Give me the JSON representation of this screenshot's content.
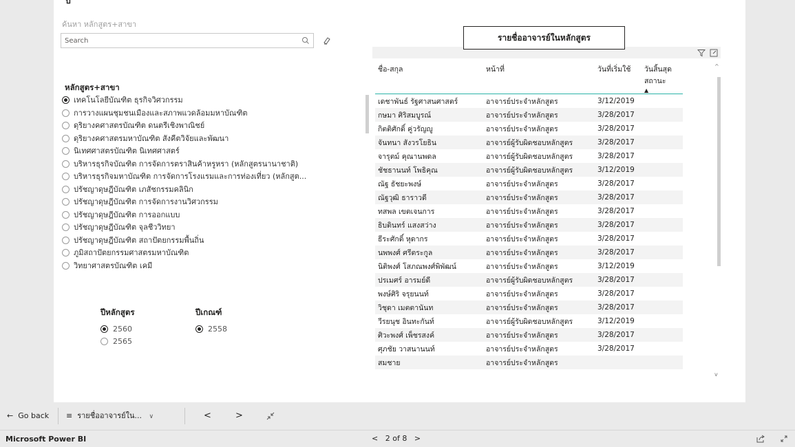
{
  "report": {
    "clipped_glyph": "ป",
    "search": {
      "caption": "ค้นหา หลักสูตร+สาขา",
      "placeholder": "Search"
    },
    "slicer": {
      "title": "หลักสูตร+สาขา",
      "items": [
        {
          "label": "เทคโนโลยีบัณฑิต ธุรกิจวิศวกรรม",
          "selected": true
        },
        {
          "label": "การวางแผนชุมชนเมืองและสภาพแวดล้อมมหาบัณฑิต",
          "selected": false
        },
        {
          "label": "ดุริยางคศาสตรบัณฑิต ดนตรีเชิงพาณิชย์",
          "selected": false
        },
        {
          "label": "ดุริยางคศาสตรมหาบัณฑิต สังคีตวิจัยและพัฒนา",
          "selected": false
        },
        {
          "label": "นิเทศศาสตรบัณฑิต นิเทศศาสตร์",
          "selected": false
        },
        {
          "label": "บริหารธุรกิจบัณฑิต การจัดการตราสินค้าหรูหรา (หลักสูตรนานาชาติ)",
          "selected": false
        },
        {
          "label": "บริหารธุรกิจมหาบัณฑิต  การจัดการโรงแรมและการท่องเที่ยว (หลักสูต...",
          "selected": false
        },
        {
          "label": "ปรัชญาดุษฎีบัณฑิต เภสัชกรรมคลินิก",
          "selected": false
        },
        {
          "label": "ปรัชญาดุษฎีบัณฑิต การจัดการงานวิศวกรรม",
          "selected": false
        },
        {
          "label": "ปรัชญาดุษฎีบัณฑิต การออกแบบ",
          "selected": false
        },
        {
          "label": "ปรัชญาดุษฎีบัณฑิต จุลชีววิทยา",
          "selected": false
        },
        {
          "label": "ปรัชญาดุษฎีบัณฑิต สถาปัตยกรรมพื้นถิ่น",
          "selected": false
        },
        {
          "label": "ภูมิสถาปัตยกรรมศาสตรมหาบัณฑิต",
          "selected": false
        },
        {
          "label": "วิทยาศาสตรบัณฑิต เคมี",
          "selected": false
        }
      ]
    },
    "course_year": {
      "title": "ปีหลักสูตร",
      "options": [
        {
          "label": "2560",
          "selected": true
        },
        {
          "label": "2565",
          "selected": false
        }
      ]
    },
    "criteria_year": {
      "title": "ปีเกณฑ์",
      "options": [
        {
          "label": "2558",
          "selected": true
        }
      ]
    },
    "table": {
      "title": "รายชื่ออาจารย์ในหลักสูตร",
      "headers": [
        "ชื่อ-สกุล",
        "หน้าที่",
        "วันที่เริ่มใช้",
        "วันสิ้นสุดสถานะ"
      ],
      "sort_indicator": "▲",
      "rows": [
        [
          "เดชาพันธ์ รัฐศาสนศาสตร์",
          "อาจารย์ประจำหลักสูตร",
          "3/12/2019",
          ""
        ],
        [
          "กษมา ศิริสมบูรณ์",
          "อาจารย์ประจำหลักสูตร",
          "3/28/2017",
          ""
        ],
        [
          "กิตติศักดิ์ คู่วรัญญู",
          "อาจารย์ประจำหลักสูตร",
          "3/28/2017",
          ""
        ],
        [
          "จันทนา สังวรโยธิน",
          "อาจารย์ผู้รับผิดชอบหลักสูตร",
          "3/28/2017",
          ""
        ],
        [
          "จารุตม์ คุณานพดล",
          "อาจารย์ผู้รับผิดชอบหลักสูตร",
          "3/28/2017",
          ""
        ],
        [
          "ชัชธานนท์ โพธิคุณ",
          "อาจารย์ผู้รับผิดชอบหลักสูตร",
          "3/12/2019",
          ""
        ],
        [
          "ณัฐ ธัชยะพงษ์",
          "อาจารย์ประจำหลักสูตร",
          "3/28/2017",
          ""
        ],
        [
          "ณัฐวุฒิ ธาราวดี",
          "อาจารย์ประจำหลักสูตร",
          "3/28/2017",
          ""
        ],
        [
          "ทสพล เขตเจนการ",
          "อาจารย์ประจำหลักสูตร",
          "3/28/2017",
          ""
        ],
        [
          "ธิบดินทร์ แสงสว่าง",
          "อาจารย์ประจำหลักสูตร",
          "3/28/2017",
          ""
        ],
        [
          "ธีระศักดิ์ หุดากร",
          "อาจารย์ประจำหลักสูตร",
          "3/28/2017",
          ""
        ],
        [
          "นพพงศ์ ศรีตระกูล",
          "อาจารย์ประจำหลักสูตร",
          "3/28/2017",
          ""
        ],
        [
          "นิติพงศ์ โสภณพงศ์พิพัฒน์",
          "อาจารย์ประจำหลักสูตร",
          "3/12/2019",
          ""
        ],
        [
          "ปรเมศร์ อารมย์ดี",
          "อาจารย์ผู้รับผิดชอบหลักสูตร",
          "3/28/2017",
          ""
        ],
        [
          "พงษ์ศิริ จรุยนนท์",
          "อาจารย์ประจำหลักสูตร",
          "3/28/2017",
          ""
        ],
        [
          "วิชุดา เมตตานันท",
          "อาจารย์ประจำหลักสูตร",
          "3/28/2017",
          ""
        ],
        [
          "วีรยนุช อินทะกันท์",
          "อาจารย์ผู้รับผิดชอบหลักสูตร",
          "3/12/2019",
          ""
        ],
        [
          "ศิวะพงศ์ เพ็ชรสงค์",
          "อาจารย์ประจำหลักสูตร",
          "3/28/2017",
          ""
        ],
        [
          "ศุภชัย วาสนานนท์",
          "อาจารย์ประจำหลักสูตร",
          "3/28/2017",
          ""
        ],
        [
          "สมชาย",
          "อาจารย์ประจำหลักสูตร",
          "",
          ""
        ]
      ]
    }
  },
  "navbar": {
    "back_label": "Go back",
    "page_select_label": "รายชื่ออาจารย์ใน...",
    "prev_glyph": "<",
    "next_glyph": ">"
  },
  "statusbar": {
    "brand": "Microsoft Power BI",
    "page_indicator": "2 of 8"
  }
}
